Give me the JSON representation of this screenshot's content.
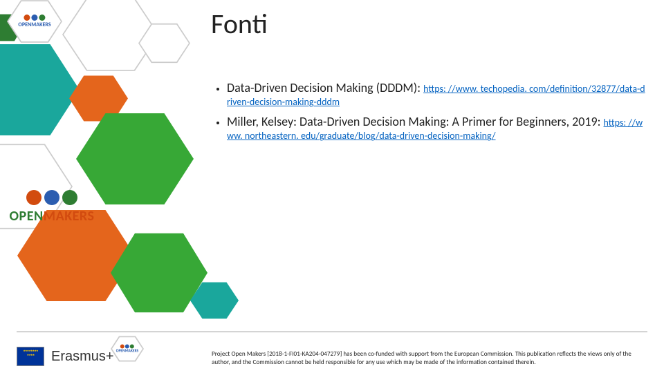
{
  "title": "Fonti",
  "bullets": [
    {
      "prefix": "Data-Driven Decision Making (DDDM): ",
      "link_text": "https: //www. techopedia. com/definition/32877/data-driven-decision-making-dddm",
      "link_href": "https://www.techopedia.com/definition/32877/data-driven-decision-making-dddm"
    },
    {
      "prefix": "Miller, Kelsey: Data-Driven Decision Making: A Primer for Beginners, 2019: ",
      "link_text": "https: //www. northeastern. edu/graduate/blog/data-driven-decision-making/",
      "link_href": "https://www.northeastern.edu/graduate/blog/data-driven-decision-making/"
    }
  ],
  "footer": {
    "erasmus": "Erasmus+",
    "disclaimer": "Project Open Makers [2018-1-FI01-KA204-047279] has been co-funded with support from the European Commission. This publication reflects the views only of the author, and the Commission cannot be held responsible for any use which may be made of the information contained therein."
  },
  "logo_label": "OPENMAKERS",
  "colors": {
    "teal": "#1aa79c",
    "green": "#37a836",
    "orange": "#e4651c",
    "link": "#0563c1"
  }
}
